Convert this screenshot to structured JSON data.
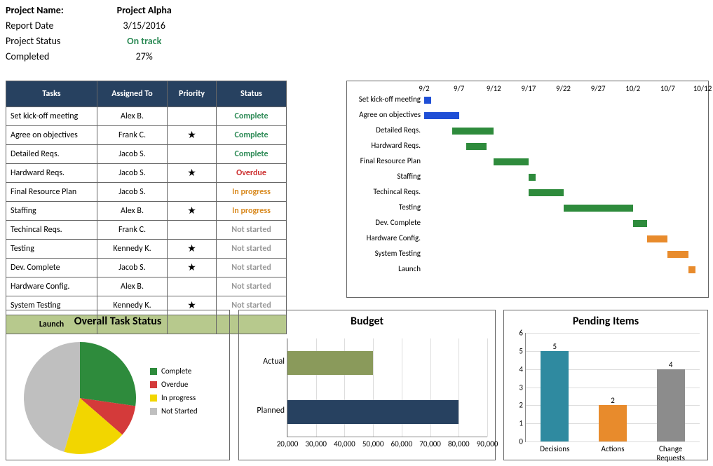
{
  "header": {
    "project_name_label": "Project Name:",
    "project_name": "Project Alpha",
    "report_date_label": "Report Date",
    "report_date": "3/15/2016",
    "project_status_label": "Project Status",
    "project_status": "On track",
    "completed_label": "Completed",
    "completed": "27%"
  },
  "task_table": {
    "columns": [
      "Tasks",
      "Assigned To",
      "Priority",
      "Status"
    ],
    "rows": [
      {
        "task": "Set kick-off meeting",
        "assigned": "Alex B.",
        "priority": false,
        "status": "Complete"
      },
      {
        "task": "Agree on objectives",
        "assigned": "Frank C.",
        "priority": true,
        "status": "Complete"
      },
      {
        "task": "Detailed Reqs.",
        "assigned": "Jacob S.",
        "priority": false,
        "status": "Complete"
      },
      {
        "task": "Hardward Reqs.",
        "assigned": "Jacob S.",
        "priority": true,
        "status": "Overdue"
      },
      {
        "task": "Final Resource Plan",
        "assigned": "Jacob S.",
        "priority": false,
        "status": "In progress"
      },
      {
        "task": "Staffing",
        "assigned": "Alex B.",
        "priority": true,
        "status": "In progress"
      },
      {
        "task": "Techincal Reqs.",
        "assigned": "Frank C.",
        "priority": false,
        "status": "Not started"
      },
      {
        "task": "Testing",
        "assigned": "Kennedy K.",
        "priority": true,
        "status": "Not started"
      },
      {
        "task": "Dev. Complete",
        "assigned": "Jacob S.",
        "priority": true,
        "status": "Not started"
      },
      {
        "task": "Hardware Config.",
        "assigned": "Alex B.",
        "priority": false,
        "status": "Not started"
      },
      {
        "task": "System Testing",
        "assigned": "Kennedy K.",
        "priority": true,
        "status": "Not started"
      }
    ],
    "launch_label": "Launch"
  },
  "chart_data": [
    {
      "id": "gantt",
      "type": "gantt",
      "title": "",
      "x_ticks": [
        "9/2",
        "9/7",
        "9/12",
        "9/17",
        "9/22",
        "9/27",
        "10/2",
        "10/7",
        "10/12"
      ],
      "x_min": "9/2",
      "x_max": "10/12",
      "rows": [
        {
          "label": "Set kick-off meeting",
          "start": "9/2",
          "end": "9/3",
          "color": "blue"
        },
        {
          "label": "Agree on objectives",
          "start": "9/2",
          "end": "9/7",
          "color": "blue"
        },
        {
          "label": "Detailed Reqs.",
          "start": "9/6",
          "end": "9/12",
          "color": "green"
        },
        {
          "label": "Hardward Reqs.",
          "start": "9/8",
          "end": "9/11",
          "color": "green"
        },
        {
          "label": "Final Resource Plan",
          "start": "9/12",
          "end": "9/17",
          "color": "green"
        },
        {
          "label": "Staffing",
          "start": "9/17",
          "end": "9/18",
          "color": "green"
        },
        {
          "label": "Techincal Reqs.",
          "start": "9/17",
          "end": "9/22",
          "color": "green"
        },
        {
          "label": "Testing",
          "start": "9/22",
          "end": "10/2",
          "color": "green"
        },
        {
          "label": "Dev. Complete",
          "start": "10/2",
          "end": "10/4",
          "color": "green"
        },
        {
          "label": "Hardware Config.",
          "start": "10/4",
          "end": "10/7",
          "color": "orange"
        },
        {
          "label": "System Testing",
          "start": "10/7",
          "end": "10/10",
          "color": "orange"
        },
        {
          "label": "Launch",
          "start": "10/10",
          "end": "10/11",
          "color": "orange"
        }
      ]
    },
    {
      "id": "overall_status",
      "type": "pie",
      "title": "Overall Task Status",
      "series": [
        {
          "name": "Complete",
          "value": 3,
          "color": "#2e8b3c"
        },
        {
          "name": "Overdue",
          "value": 1,
          "color": "#d43a3a"
        },
        {
          "name": "In progress",
          "value": 2,
          "color": "#f2d600"
        },
        {
          "name": "Not Started",
          "value": 5,
          "color": "#bfbfbf"
        }
      ]
    },
    {
      "id": "budget",
      "type": "bar",
      "orientation": "horizontal",
      "title": "Budget",
      "xlim": [
        20000,
        90000
      ],
      "x_ticks": [
        20000,
        30000,
        40000,
        50000,
        60000,
        70000,
        80000,
        90000
      ],
      "categories": [
        "Actual",
        "Planned"
      ],
      "values": [
        50000,
        80000
      ],
      "colors": [
        "#8a9a5b",
        "#274160"
      ]
    },
    {
      "id": "pending",
      "type": "bar",
      "orientation": "vertical",
      "title": "Pending Items",
      "ylim": [
        0,
        6
      ],
      "y_ticks": [
        0,
        1,
        2,
        3,
        4,
        5,
        6
      ],
      "categories": [
        "Decisions",
        "Actions",
        "Change Requests"
      ],
      "values": [
        5,
        2,
        4
      ],
      "colors": [
        "#2f8aa0",
        "#e88b2c",
        "#8c8c8c"
      ]
    }
  ]
}
